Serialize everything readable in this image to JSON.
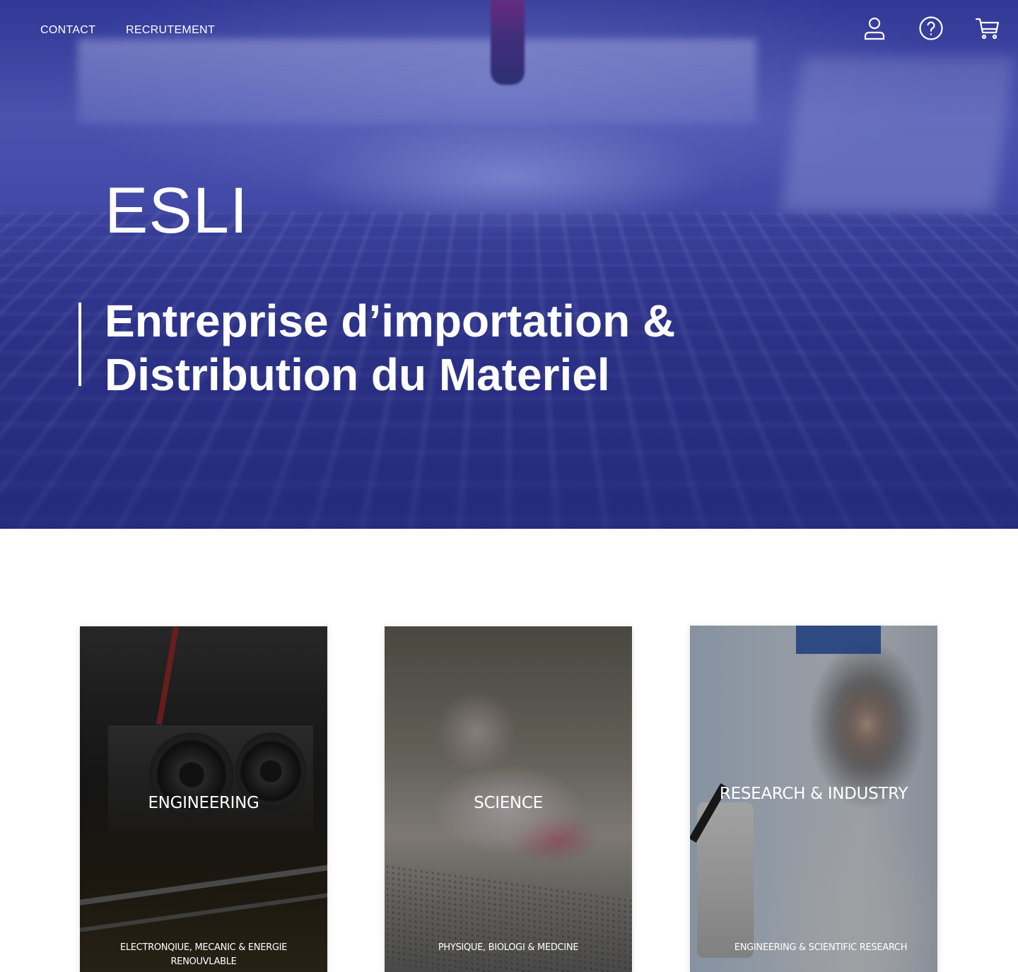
{
  "nav": {
    "links": [
      {
        "label": "CONTACT"
      },
      {
        "label": "RECRUTEMENT"
      }
    ],
    "icons": [
      "user-icon",
      "help-icon",
      "cart-icon"
    ]
  },
  "hero": {
    "brand": "ESLI",
    "tagline_line1": "Entreprise d’importation &",
    "tagline_line2": "Distribution du Materiel",
    "tint_color": "#343b99"
  },
  "cards": [
    {
      "title": "ENGINEERING",
      "subtitle_line1": "ELECTRONQIUE, MECANIC & ENERGIE",
      "subtitle_line2": "RENOUVLABLE"
    },
    {
      "title": "SCIENCE",
      "subtitle_line1": "PHYSIQUE, BIOLOGI & MEDCINE"
    },
    {
      "title": "RESEARCH & INDUSTRY",
      "subtitle_line1": "ENGINEERING & SCIENTIFIC RESEARCH"
    }
  ]
}
